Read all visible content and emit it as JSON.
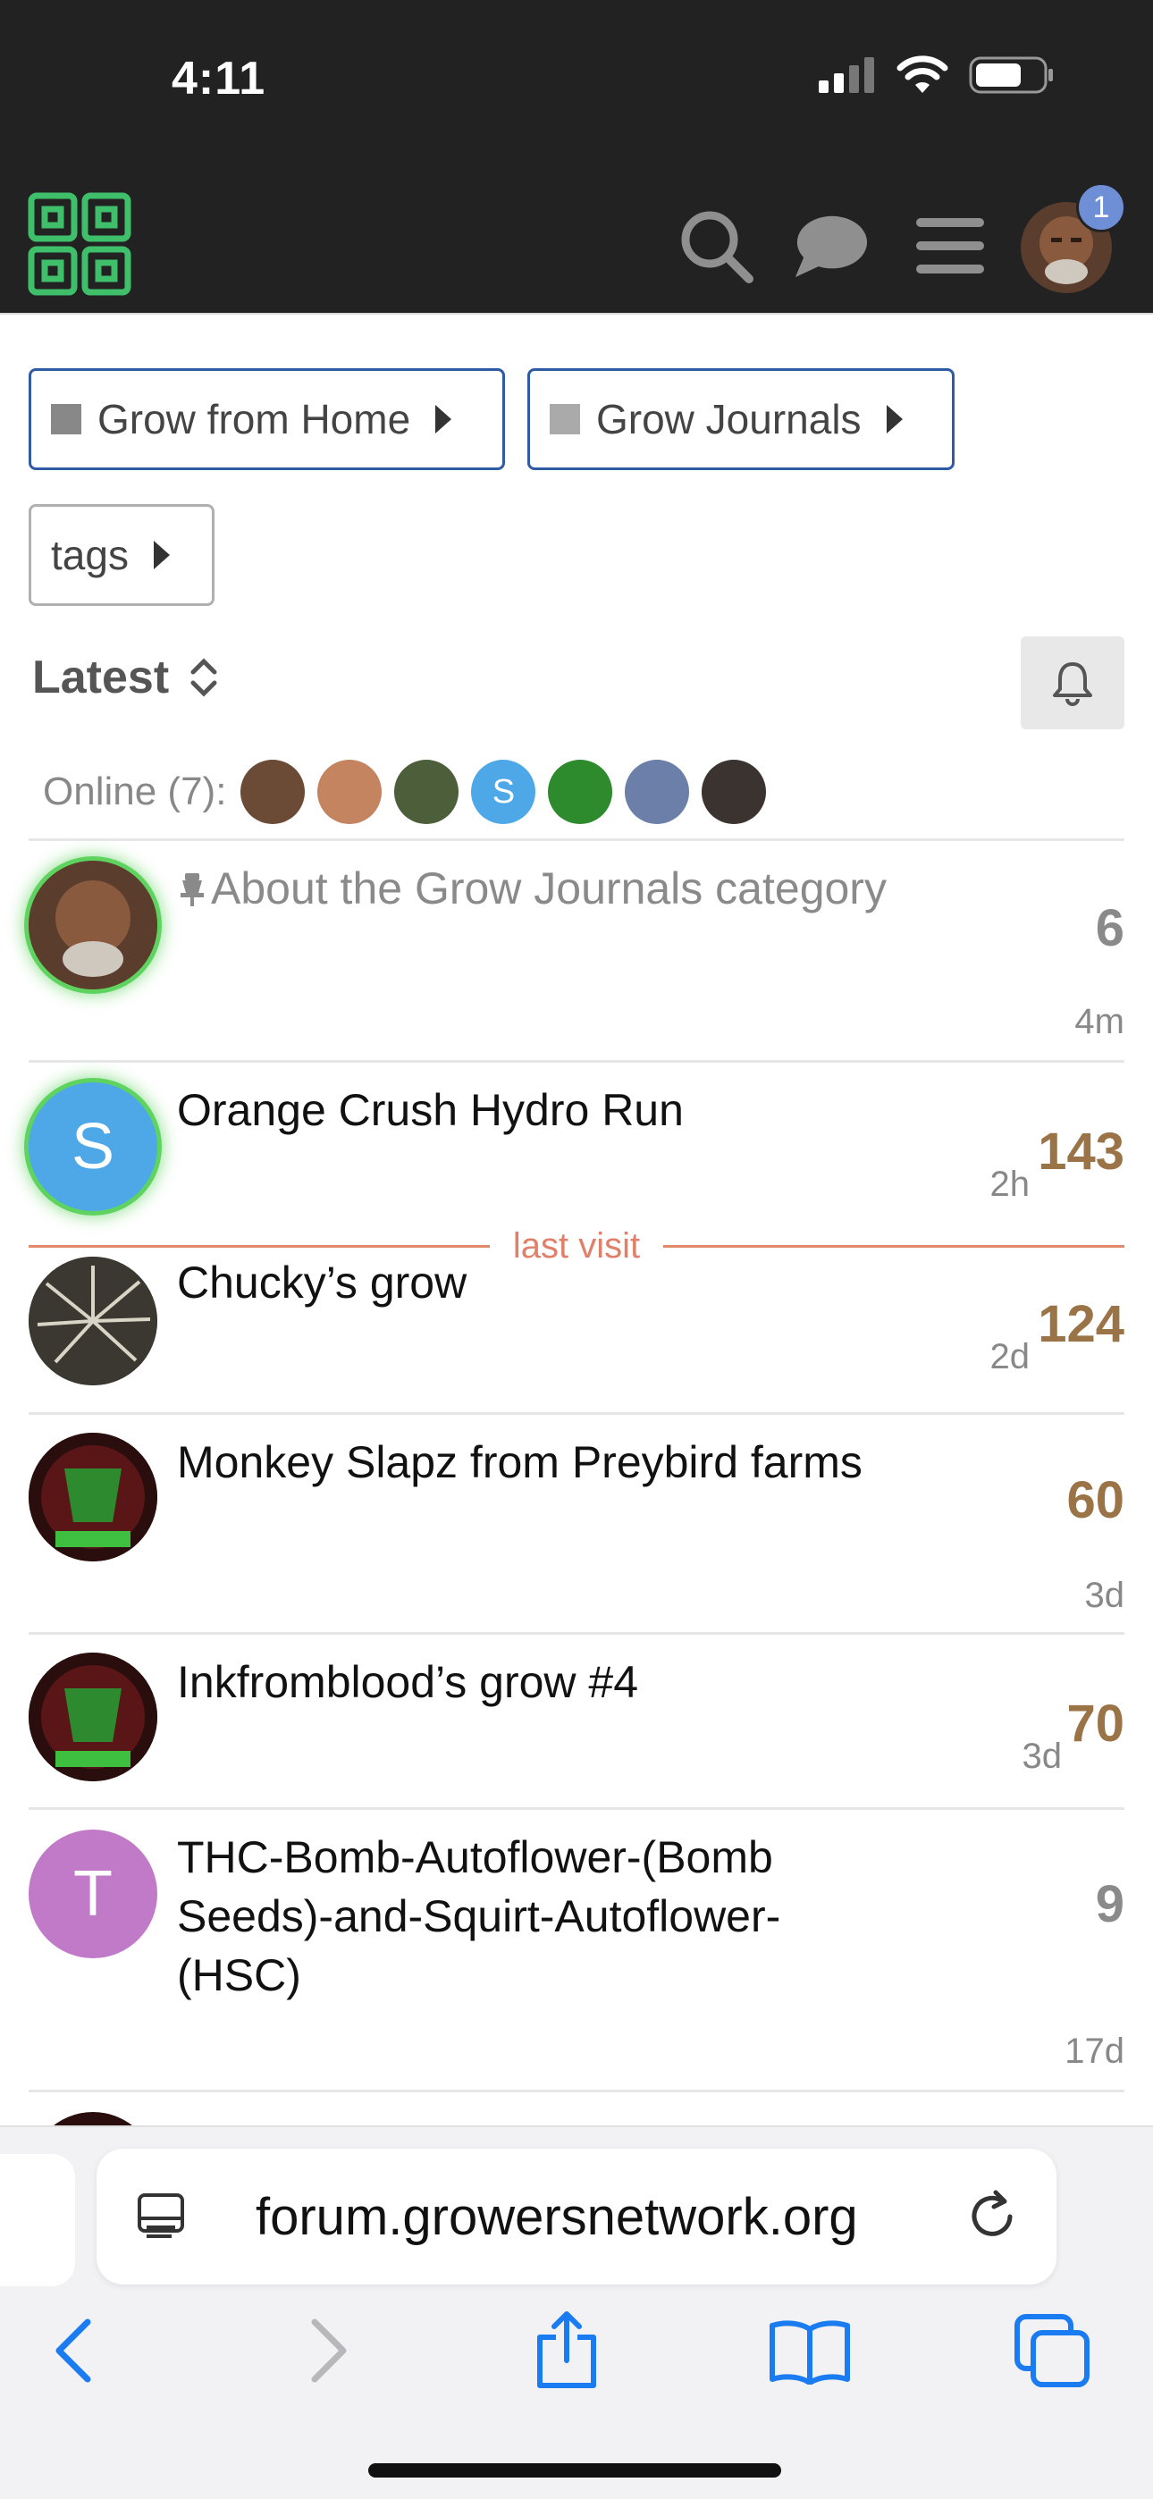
{
  "status": {
    "time": "4:11"
  },
  "header": {
    "notification_count": "1"
  },
  "breadcrumbs": [
    {
      "label": "Grow from Home"
    },
    {
      "label": "Grow Journals"
    },
    {
      "label": "tags"
    }
  ],
  "list_filter": {
    "label": "Latest"
  },
  "online": {
    "label": "Online (7):",
    "avatars": [
      "",
      "",
      "",
      "S",
      "",
      "",
      ""
    ]
  },
  "topics": [
    {
      "title": "About the Grow Journals category",
      "count": "6",
      "age": "4m",
      "pinned": true
    },
    {
      "title": "Orange Crush Hydro Run",
      "count": "143",
      "age": "2h",
      "avatar_letter": "S"
    },
    {
      "title": "Chucky’s grow",
      "count": "124",
      "age": "2d"
    },
    {
      "title": "Monkey Slapz from Preybird farms",
      "count": "60",
      "age": "3d"
    },
    {
      "title": "Inkfromblood’s grow #4",
      "count": "70",
      "age": "3d"
    },
    {
      "title": "THC-Bomb-Autoflower-(Bomb Seeds)-and-Squirt-Autoflower-(HSC)",
      "count": "9",
      "age": "17d",
      "avatar_letter": "T"
    }
  ],
  "last_visit_label": "last visit",
  "browser": {
    "url": "forum.growersnetwork.org"
  },
  "colors": {
    "accent_blue": "#2f5aa4",
    "hot_count": "#9a7346",
    "last_visit": "#e0806a",
    "ios_blue": "#1a7cf0"
  }
}
